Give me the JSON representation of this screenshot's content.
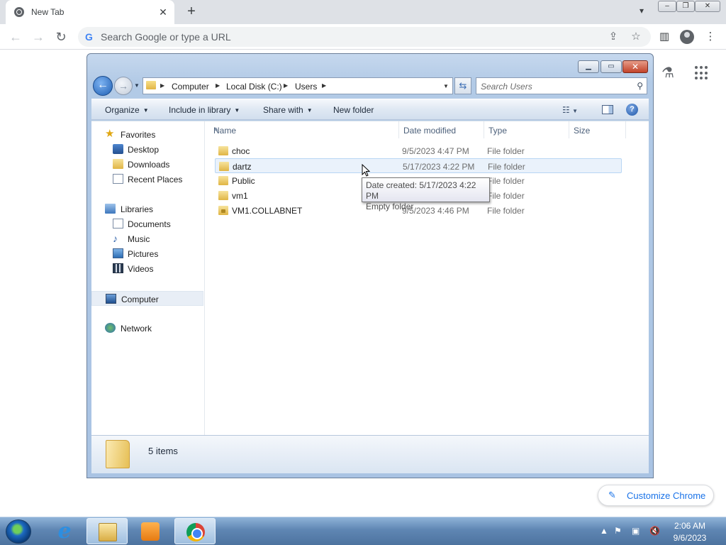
{
  "browser": {
    "tab_title": "New Tab",
    "tab_close": "✕",
    "new_tab": "+",
    "omnibox_placeholder": "Search Google or type a URL",
    "g_letter": "G",
    "customize_label": "Customize Chrome",
    "accent_color": "#1a73e8"
  },
  "explorer": {
    "breadcrumbs": [
      "Computer",
      "Local Disk (C:)",
      "Users"
    ],
    "search_placeholder": "Search Users",
    "commands": {
      "organize": "Organize",
      "include_in_library": "Include in library",
      "share_with": "Share with",
      "new_folder": "New folder"
    },
    "nav": {
      "favorites": "Favorites",
      "desktop": "Desktop",
      "downloads": "Downloads",
      "recent_places": "Recent Places",
      "libraries": "Libraries",
      "documents": "Documents",
      "music": "Music",
      "pictures": "Pictures",
      "videos": "Videos",
      "computer": "Computer",
      "network": "Network"
    },
    "columns": {
      "name": "Name",
      "date_modified": "Date modified",
      "type": "Type",
      "size": "Size"
    },
    "rows": [
      {
        "name": "choc",
        "date": "9/5/2023 4:47 PM",
        "type": "File folder"
      },
      {
        "name": "dartz",
        "date": "5/17/2023 4:22 PM",
        "type": "File folder"
      },
      {
        "name": "Public",
        "date": "",
        "type": "File folder"
      },
      {
        "name": "vm1",
        "date": "",
        "type": "File folder"
      },
      {
        "name": "VM1.COLLABNET",
        "date": "9/5/2023 4:46 PM",
        "type": "File folder"
      }
    ],
    "tooltip": {
      "line1": "Date created: 5/17/2023 4:22 PM",
      "line2": "Empty folder"
    },
    "item_count": "5 items"
  },
  "taskbar": {
    "time": "2:06 AM",
    "date": "9/6/2023"
  }
}
